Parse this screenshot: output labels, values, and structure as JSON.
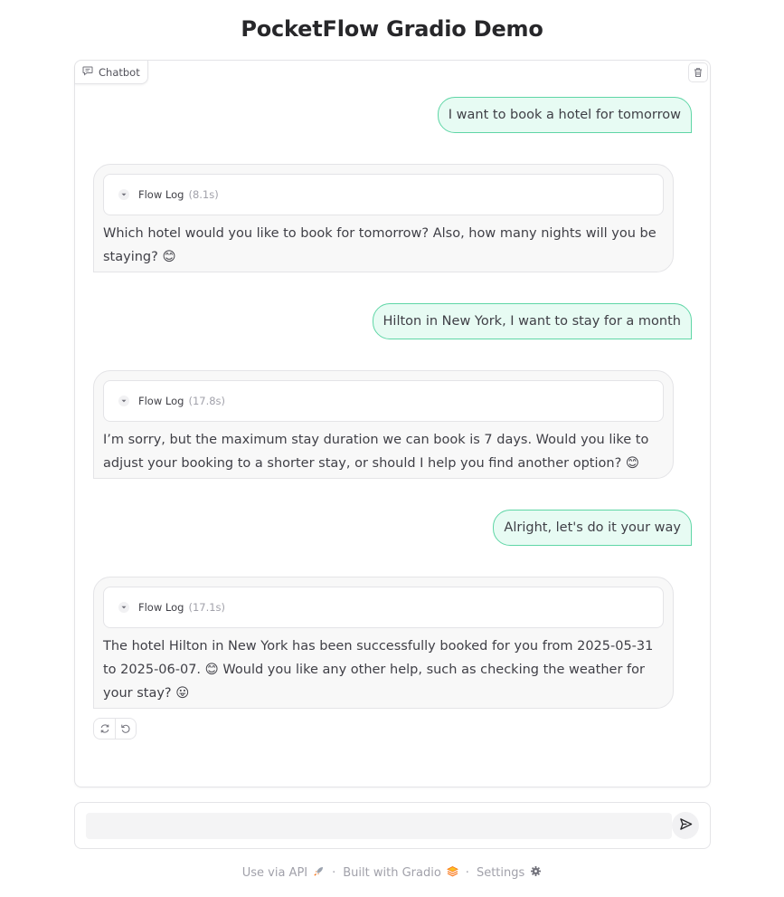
{
  "page": {
    "title": "PocketFlow Gradio Demo"
  },
  "chatbot": {
    "label": "Chatbot",
    "messages": [
      {
        "role": "user",
        "text": "I want to book a hotel for tomorrow"
      },
      {
        "role": "assistant",
        "flow_log_label": "Flow Log",
        "flow_log_time": "(8.1s)",
        "text": "Which hotel would you like to book for tomorrow? Also, how many nights will you be staying?",
        "emojis": "😊"
      },
      {
        "role": "user",
        "text": "Hilton in New York, I want to stay for a month"
      },
      {
        "role": "assistant",
        "flow_log_label": "Flow Log",
        "flow_log_time": "(17.8s)",
        "text": "I’m sorry, but the maximum stay duration we can book is 7 days. Would you like to adjust your booking to a shorter stay, or should I help you find another option?",
        "emojis": "😊"
      },
      {
        "role": "user",
        "text": "Alright, let's do it your way"
      },
      {
        "role": "assistant",
        "flow_log_label": "Flow Log",
        "flow_log_time": "(17.1s)",
        "text_part1": "The hotel Hilton in New York has been successfully booked for you from 2025-05-31 to 2025-06-07.",
        "emoji1": "😊",
        "text_part2": "Would you like any other help, such as checking the weather for your stay?",
        "emoji2": "😛"
      }
    ]
  },
  "input": {
    "value": "",
    "placeholder": ""
  },
  "footer": {
    "api_label": "Use via API",
    "built_label": "Built with Gradio",
    "settings_label": "Settings",
    "separator": "·"
  },
  "colors": {
    "user_bubble_bg": "#e7fbf3",
    "user_bubble_border": "#5fd6a6",
    "bot_bubble_bg": "#f8f8f8",
    "panel_border": "#e4e4e7",
    "accent_orange": "#f97316"
  },
  "icons": {
    "chat_label": "chat-icon",
    "clear": "trash-icon",
    "retry": "retry-icon",
    "undo": "undo-icon",
    "send": "send-icon",
    "flow_log": "caret-down-icon",
    "api": "rocket-icon",
    "gradio": "gradio-logo-icon",
    "settings": "gear-icon"
  }
}
